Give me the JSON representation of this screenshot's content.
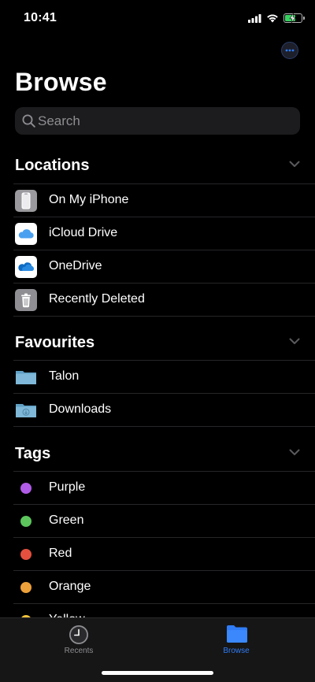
{
  "status_bar": {
    "time": "10:41",
    "battery_level": 0.7,
    "battery_color": "#37d462"
  },
  "header": {
    "more_icon": "ellipsis-circle-icon",
    "title": "Browse"
  },
  "search": {
    "placeholder": "Search",
    "icon": "search-icon"
  },
  "sections": {
    "locations": {
      "title": "Locations",
      "items": [
        {
          "label": "On My iPhone",
          "icon": "iphone-icon"
        },
        {
          "label": "iCloud Drive",
          "icon": "icloud-icon"
        },
        {
          "label": "OneDrive",
          "icon": "onedrive-icon"
        },
        {
          "label": "Recently Deleted",
          "icon": "trash-icon"
        }
      ]
    },
    "favourites": {
      "title": "Favourites",
      "items": [
        {
          "label": "Talon",
          "icon": "folder-icon"
        },
        {
          "label": "Downloads",
          "icon": "downloads-folder-icon"
        }
      ]
    },
    "tags": {
      "title": "Tags",
      "items": [
        {
          "label": "Purple",
          "color": "#b15ce6"
        },
        {
          "label": "Green",
          "color": "#5cc55c"
        },
        {
          "label": "Red",
          "color": "#e3503e"
        },
        {
          "label": "Orange",
          "color": "#eda13a"
        },
        {
          "label": "Yellow",
          "color": "#f2c43a"
        }
      ]
    }
  },
  "tab_bar": {
    "tabs": [
      {
        "label": "Recents",
        "icon": "clock-icon",
        "active": false,
        "color": "#8e8e93"
      },
      {
        "label": "Browse",
        "icon": "folder-icon",
        "active": true,
        "color": "#2f7cf6"
      }
    ]
  }
}
